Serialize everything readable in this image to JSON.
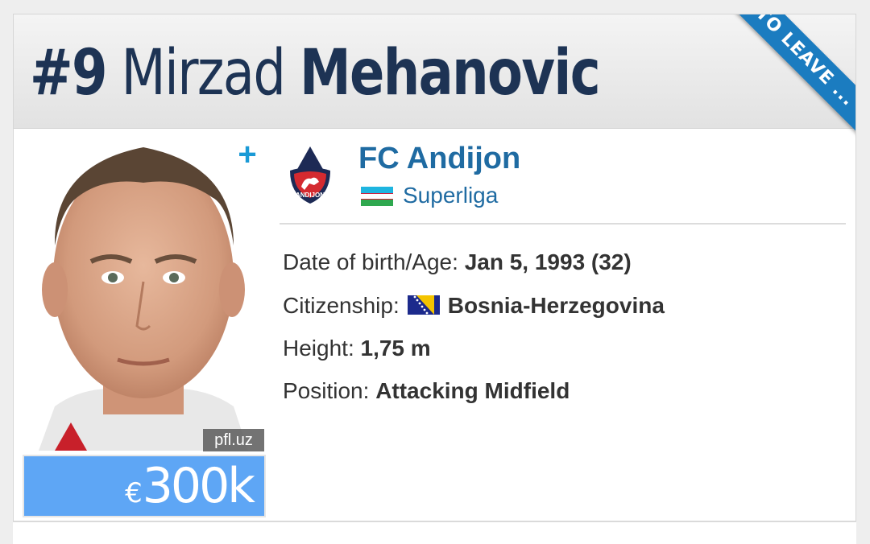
{
  "header": {
    "number": "#9",
    "first_name": "Mirzad",
    "last_name": "Mehanovic"
  },
  "ribbon": {
    "label": "TO LEAVE ..."
  },
  "player": {
    "photo_credit": "pfl.uz",
    "market_value_currency": "€",
    "market_value_amount": "300k",
    "plus_label": "+"
  },
  "club": {
    "name": "FC Andijon",
    "league": "Superliga",
    "league_flag_icon": "uzbekistan-flag-icon",
    "logo_icon": "fc-andijon-crest-icon",
    "logo_text": "ANDIJON"
  },
  "details": {
    "dob_label": "Date of birth/Age:",
    "dob_value": "Jan 5, 1993 (32)",
    "citizenship_label": "Citizenship:",
    "citizenship_value": "Bosnia-Herzegovina",
    "citizenship_flag_icon": "bosnia-flag-icon",
    "height_label": "Height:",
    "height_value": "1,75 m",
    "position_label": "Position:",
    "position_value": "Attacking Midfield"
  },
  "colors": {
    "title": "#1d3354",
    "link": "#1f6ba2",
    "ribbon": "#1b7cc0",
    "value_box": "#5ea6f5"
  }
}
